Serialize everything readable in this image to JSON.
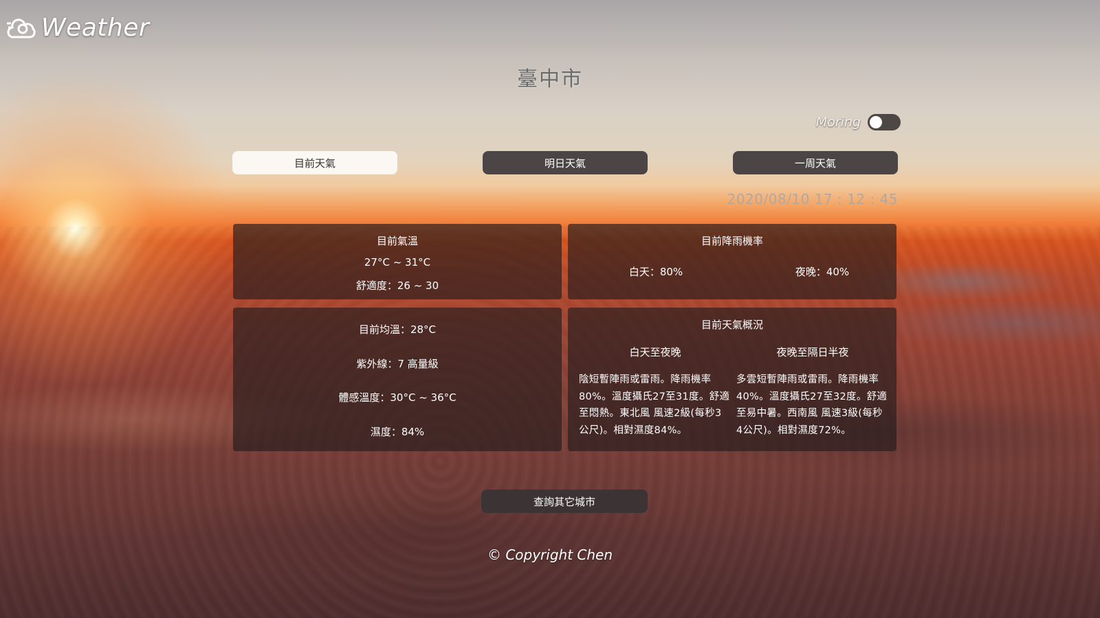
{
  "app": {
    "logo_text": "Weather",
    "logo_icon": "cloud-sun-icon"
  },
  "city": "臺中市",
  "toggle": {
    "label": "Moring",
    "state": "off"
  },
  "tabs": [
    {
      "label": "目前天氣",
      "active": true
    },
    {
      "label": "明日天氣",
      "active": false
    },
    {
      "label": "一周天氣",
      "active": false
    }
  ],
  "datetime": "2020/08/10 17 : 12 : 45",
  "temperature_panel": {
    "title": "目前氣溫",
    "range": "27°C ~ 31°C",
    "comfort": "舒適度：26 ~ 30"
  },
  "rain_panel": {
    "title": "目前降雨機率",
    "day": "白天：80%",
    "night": "夜晚：40%"
  },
  "detail_panel": {
    "avg_temp": "目前均溫：28°C",
    "uv": "紫外線：7 高量級",
    "feels_like": "體感溫度：30°C ~ 36°C",
    "humidity": "濕度：84%"
  },
  "overview_panel": {
    "title": "目前天氣概況",
    "day_title": "白天至夜晚",
    "day_text": "陰短暫陣雨或雷雨。降雨機率 80%。溫度攝氏27至31度。舒適至悶熱。東北風 風速2級(每秒3公尺)。相對濕度84%。",
    "night_title": "夜晚至隔日半夜",
    "night_text": "多雲短暫陣雨或雷雨。降雨機率 40%。溫度攝氏27至32度。舒適至易中暑。西南風 風速3級(每秒4公尺)。相對濕度72%。"
  },
  "query_button": "查詢其它城市",
  "copyright": "© Copyright Chen",
  "colors": {
    "panel_bg": "#281e1e",
    "button_dark": "#4b4645",
    "tab_active": "#fbf7f2"
  }
}
